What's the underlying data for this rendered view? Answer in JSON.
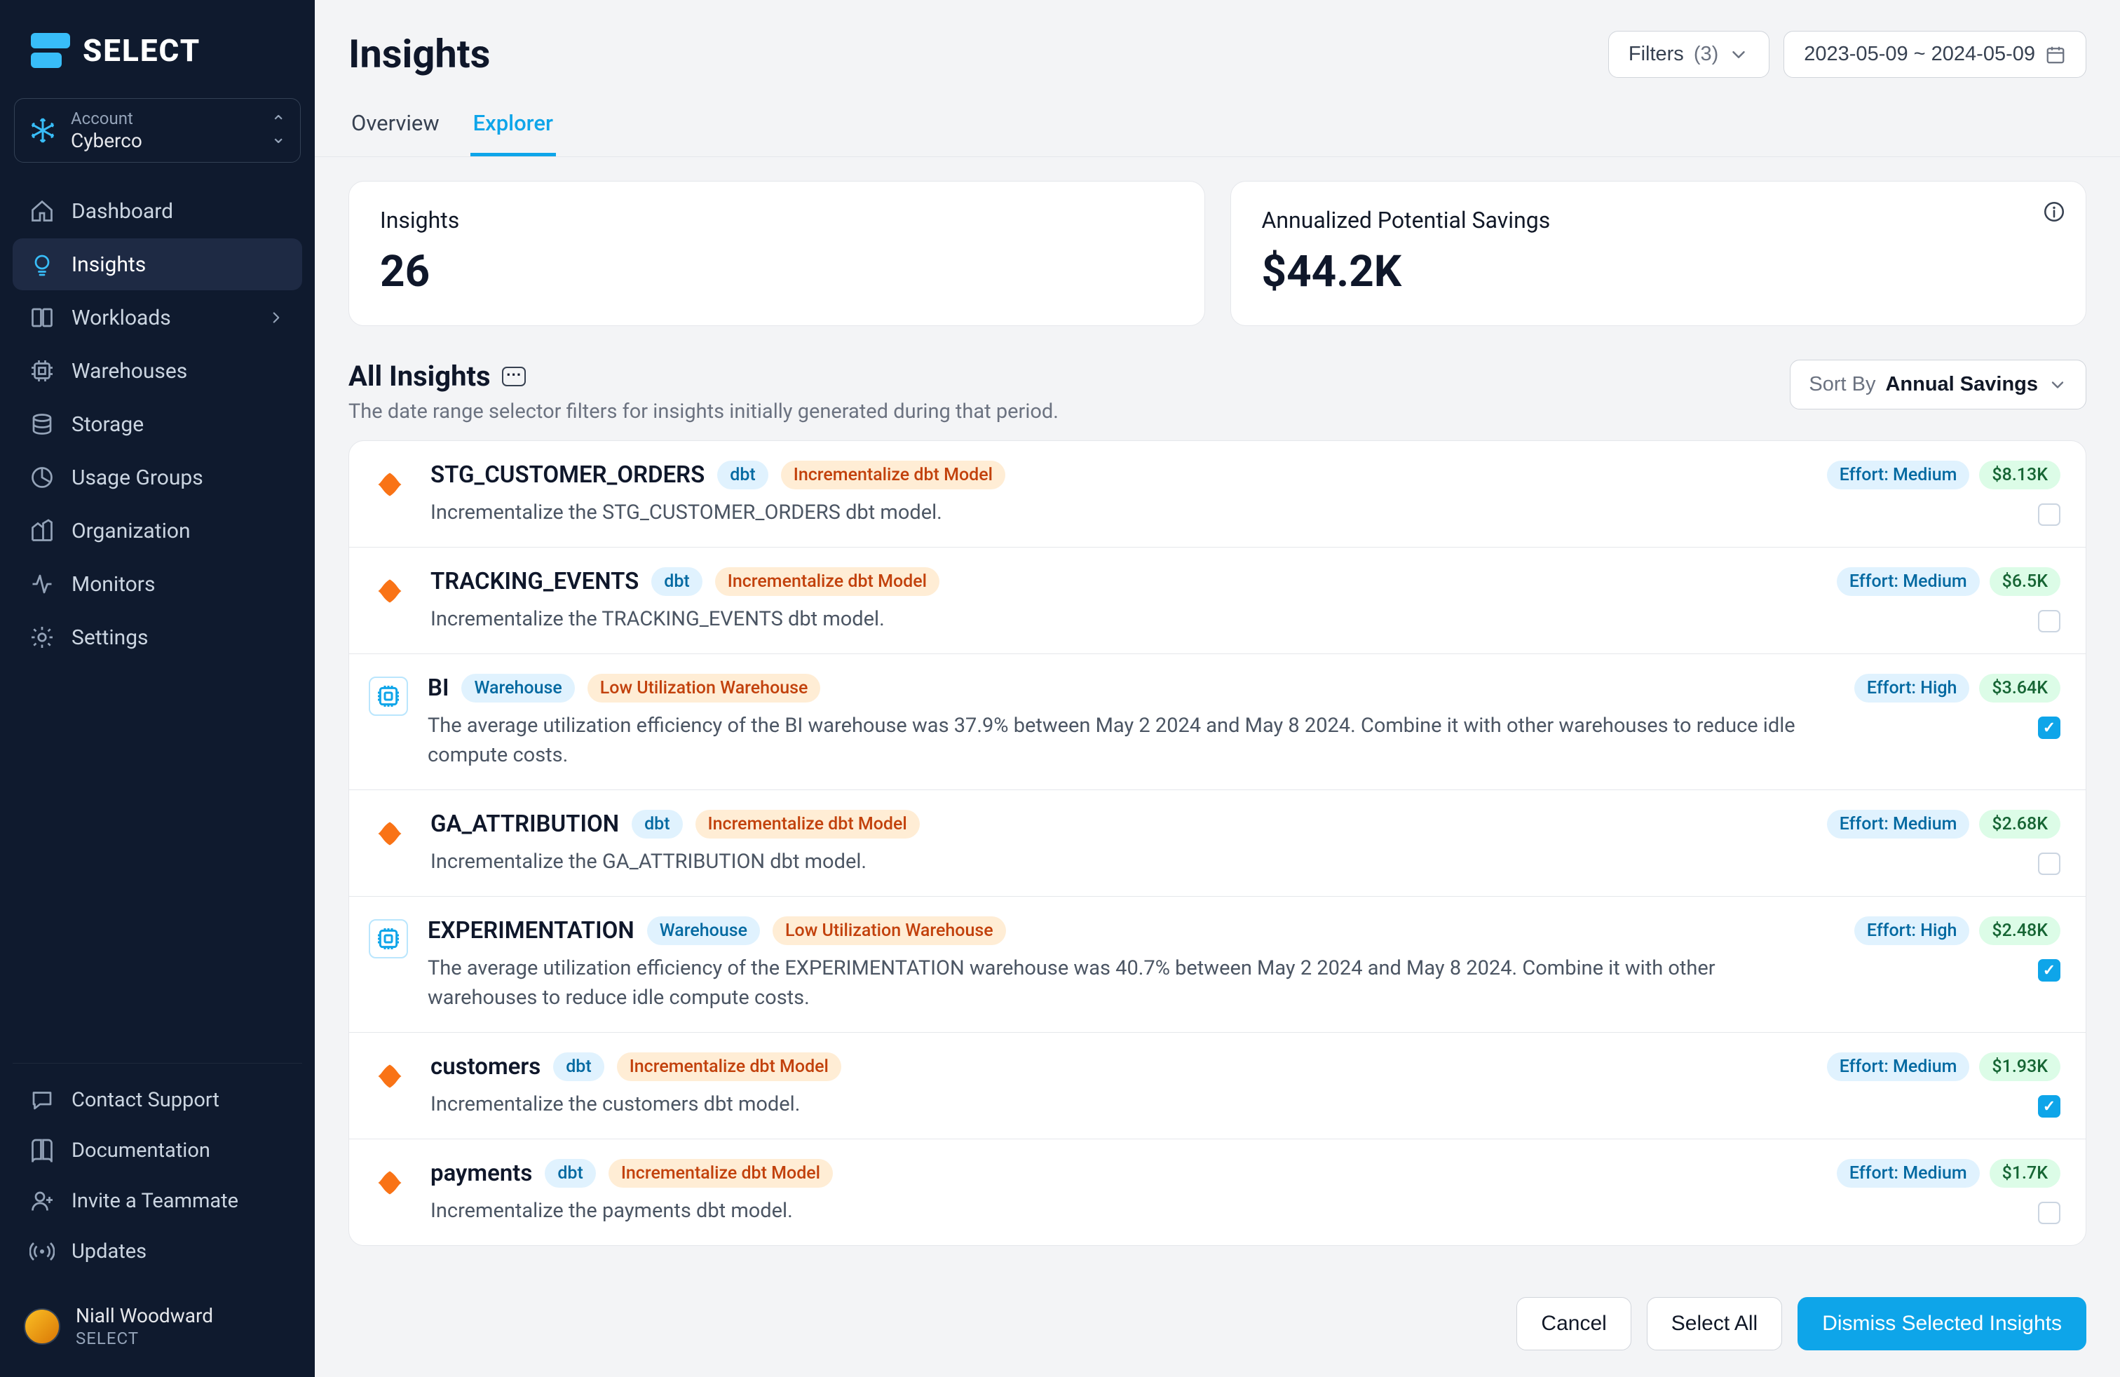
{
  "brand_name": "SELECT",
  "account": {
    "label": "Account",
    "value": "Cyberco"
  },
  "nav": {
    "dashboard": "Dashboard",
    "insights": "Insights",
    "workloads": "Workloads",
    "warehouses": "Warehouses",
    "storage": "Storage",
    "usage_groups": "Usage Groups",
    "organization": "Organization",
    "monitors": "Monitors",
    "settings": "Settings"
  },
  "bottom_nav": {
    "contact_support": "Contact Support",
    "documentation": "Documentation",
    "invite": "Invite a Teammate",
    "updates": "Updates"
  },
  "user": {
    "name": "Niall Woodward",
    "org": "SELECT"
  },
  "page": {
    "title": "Insights"
  },
  "tabs": {
    "overview": "Overview",
    "explorer": "Explorer"
  },
  "filters": {
    "label": "Filters",
    "count": "(3)"
  },
  "date_range": "2023-05-09 ~ 2024-05-09",
  "kpi": {
    "insights_label": "Insights",
    "insights_value": "26",
    "savings_label": "Annualized Potential Savings",
    "savings_value": "$44.2K"
  },
  "section": {
    "title": "All Insights",
    "sub": "The date range selector filters for insights initially generated during that period."
  },
  "sort": {
    "label": "Sort By",
    "value": "Annual Savings"
  },
  "tags": {
    "dbt": "dbt",
    "inc": "Incrementalize dbt Model",
    "wh": "Warehouse",
    "low": "Low Utilization Warehouse"
  },
  "rows": [
    {
      "icon": "dbt",
      "title": "STG_CUSTOMER_ORDERS",
      "tag1": "dbt",
      "tag2": "inc",
      "desc": "Incrementalize the STG_CUSTOMER_ORDERS dbt model.",
      "effort": "Effort: Medium",
      "savings": "$8.13K",
      "checked": false
    },
    {
      "icon": "dbt",
      "title": "TRACKING_EVENTS",
      "tag1": "dbt",
      "tag2": "inc",
      "desc": "Incrementalize the TRACKING_EVENTS dbt model.",
      "effort": "Effort: Medium",
      "savings": "$6.5K",
      "checked": false
    },
    {
      "icon": "wh",
      "title": "BI",
      "tag1": "wh",
      "tag2": "low",
      "desc": "The average utilization efficiency of the BI warehouse was 37.9% between May 2 2024 and May 8 2024. Combine it with other warehouses to reduce idle compute costs.",
      "effort": "Effort: High",
      "savings": "$3.64K",
      "checked": true
    },
    {
      "icon": "dbt",
      "title": "GA_ATTRIBUTION",
      "tag1": "dbt",
      "tag2": "inc",
      "desc": "Incrementalize the GA_ATTRIBUTION dbt model.",
      "effort": "Effort: Medium",
      "savings": "$2.68K",
      "checked": false
    },
    {
      "icon": "wh",
      "title": "EXPERIMENTATION",
      "tag1": "wh",
      "tag2": "low",
      "desc": "The average utilization efficiency of the EXPERIMENTATION warehouse was 40.7% between May 2 2024 and May 8 2024. Combine it with other warehouses to reduce idle compute costs.",
      "effort": "Effort: High",
      "savings": "$2.48K",
      "checked": true
    },
    {
      "icon": "dbt",
      "title": "customers",
      "tag1": "dbt",
      "tag2": "inc",
      "desc": "Incrementalize the customers dbt model.",
      "effort": "Effort: Medium",
      "savings": "$1.93K",
      "checked": true
    },
    {
      "icon": "dbt",
      "title": "payments",
      "tag1": "dbt",
      "tag2": "inc",
      "desc": "Incrementalize the payments dbt model.",
      "effort": "Effort: Medium",
      "savings": "$1.7K",
      "checked": false
    }
  ],
  "footer": {
    "cancel": "Cancel",
    "select_all": "Select All",
    "dismiss": "Dismiss Selected Insights"
  }
}
